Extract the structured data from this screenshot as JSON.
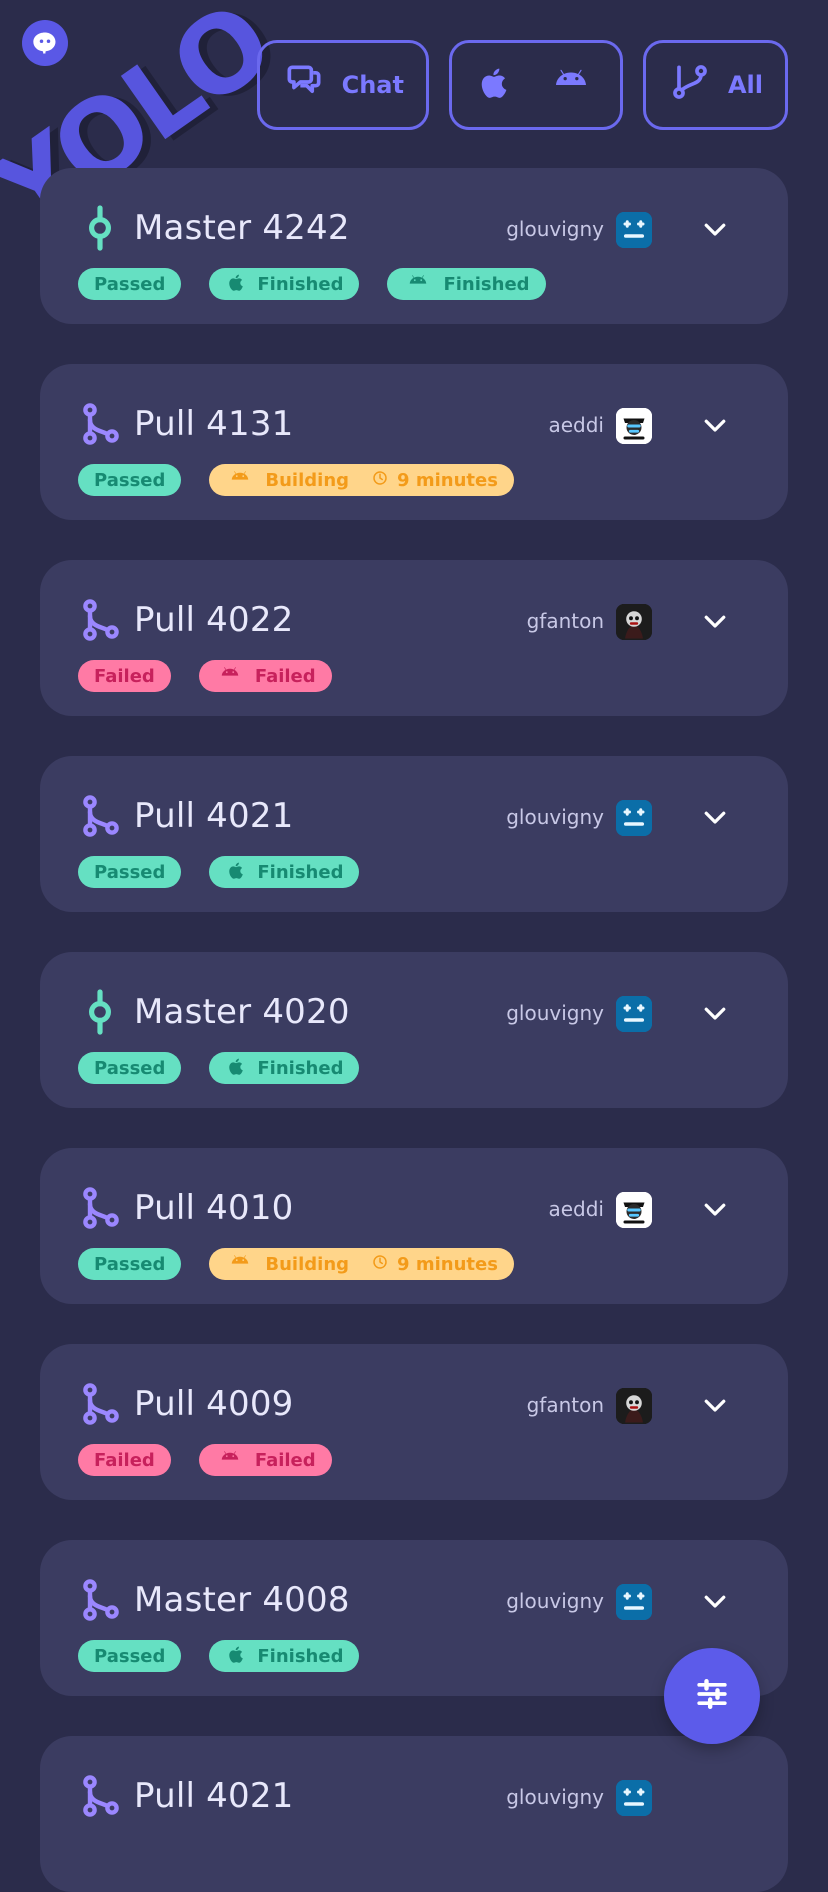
{
  "app": {
    "logo_text": "YOLO"
  },
  "header": {
    "filters": [
      {
        "key": "chat",
        "label": "Chat",
        "icon": "chat-icon"
      },
      {
        "key": "platforms",
        "label": "",
        "icon": "apple-android-icons"
      },
      {
        "key": "all",
        "label": "All",
        "icon": "branch-icon"
      }
    ]
  },
  "builds": [
    {
      "type": "master",
      "title": "Master 4242",
      "author": "glouvigny",
      "avatar": "robot",
      "badges": [
        {
          "kind": "passed",
          "label": "Passed"
        },
        {
          "kind": "finished",
          "platform": "apple",
          "label": "Finished"
        },
        {
          "kind": "finished",
          "platform": "android",
          "label": "Finished"
        }
      ]
    },
    {
      "type": "pull",
      "title": "Pull 4131",
      "author": "aeddi",
      "avatar": "mask",
      "badges": [
        {
          "kind": "passed",
          "label": "Passed"
        },
        {
          "kind": "building",
          "platform": "android",
          "label": "Building",
          "time": "9 minutes"
        }
      ]
    },
    {
      "type": "pull",
      "title": "Pull 4022",
      "author": "gfanton",
      "avatar": "skull",
      "badges": [
        {
          "kind": "failed",
          "label": "Failed"
        },
        {
          "kind": "failed",
          "platform": "android",
          "label": "Failed"
        }
      ]
    },
    {
      "type": "pull",
      "title": "Pull 4021",
      "author": "glouvigny",
      "avatar": "robot",
      "badges": [
        {
          "kind": "passed",
          "label": "Passed"
        },
        {
          "kind": "finished",
          "platform": "apple",
          "label": "Finished"
        }
      ]
    },
    {
      "type": "master",
      "title": "Master 4020",
      "author": "glouvigny",
      "avatar": "robot",
      "badges": [
        {
          "kind": "passed",
          "label": "Passed"
        },
        {
          "kind": "finished",
          "platform": "apple",
          "label": "Finished"
        }
      ]
    },
    {
      "type": "pull",
      "title": "Pull 4010",
      "author": "aeddi",
      "avatar": "mask",
      "badges": [
        {
          "kind": "passed",
          "label": "Passed"
        },
        {
          "kind": "building",
          "platform": "android",
          "label": "Building",
          "time": "9 minutes"
        }
      ]
    },
    {
      "type": "pull",
      "title": "Pull 4009",
      "author": "gfanton",
      "avatar": "skull",
      "badges": [
        {
          "kind": "failed",
          "label": "Failed"
        },
        {
          "kind": "failed",
          "platform": "android",
          "label": "Failed"
        }
      ]
    },
    {
      "type": "pull",
      "title": "Master 4008",
      "author": "glouvigny",
      "avatar": "robot",
      "badges": [
        {
          "kind": "passed",
          "label": "Passed"
        },
        {
          "kind": "finished",
          "platform": "apple",
          "label": "Finished"
        }
      ]
    },
    {
      "type": "pull",
      "title": "Pull 4021",
      "author": "glouvigny",
      "avatar": "robot",
      "badges": []
    }
  ],
  "colors": {
    "background": "#2b2c4b",
    "card": "#3b3c61",
    "accent": "#5c5bea",
    "passed_bg": "#65e0c2",
    "failed_bg": "#ff7aa5",
    "building_bg": "#ffd58a"
  },
  "fab": {
    "icon": "sliders-icon"
  }
}
